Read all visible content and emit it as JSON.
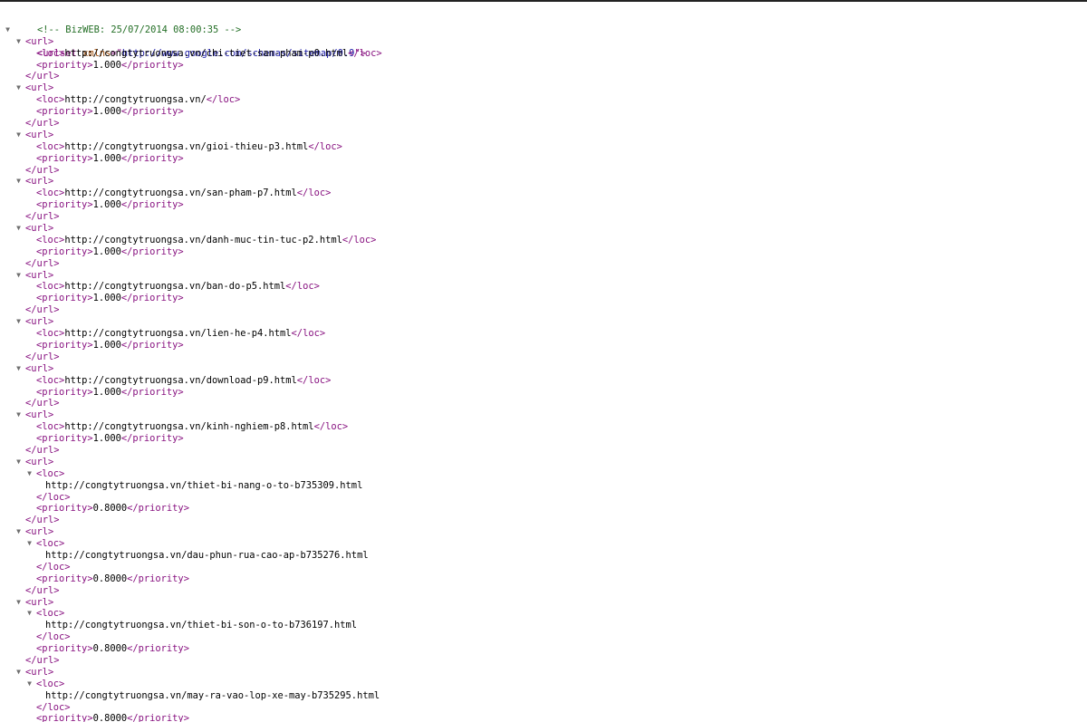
{
  "comment": "<!-- BizWEB: 25/07/2014 08:00:35 -->",
  "root_tag": "urlset",
  "root_attr_name": "xmlns",
  "root_attr_value": "http://www.google.com/schemas/sitemap/0.9",
  "tags": {
    "url": "url",
    "loc": "loc",
    "priority": "priority"
  },
  "fold_glyph": "▼",
  "urls": [
    {
      "loc": "http://congtytruongsa.vn/chi-tiet-san-pham-p0.html",
      "priority": "1.000",
      "expanded_loc": false
    },
    {
      "loc": "http://congtytruongsa.vn/",
      "priority": "1.000",
      "expanded_loc": false
    },
    {
      "loc": "http://congtytruongsa.vn/gioi-thieu-p3.html",
      "priority": "1.000",
      "expanded_loc": false
    },
    {
      "loc": "http://congtytruongsa.vn/san-pham-p7.html",
      "priority": "1.000",
      "expanded_loc": false
    },
    {
      "loc": "http://congtytruongsa.vn/danh-muc-tin-tuc-p2.html",
      "priority": "1.000",
      "expanded_loc": false
    },
    {
      "loc": "http://congtytruongsa.vn/ban-do-p5.html",
      "priority": "1.000",
      "expanded_loc": false
    },
    {
      "loc": "http://congtytruongsa.vn/lien-he-p4.html",
      "priority": "1.000",
      "expanded_loc": false
    },
    {
      "loc": "http://congtytruongsa.vn/download-p9.html",
      "priority": "1.000",
      "expanded_loc": false
    },
    {
      "loc": "http://congtytruongsa.vn/kinh-nghiem-p8.html",
      "priority": "1.000",
      "expanded_loc": false
    },
    {
      "loc": "http://congtytruongsa.vn/thiet-bi-nang-o-to-b735309.html",
      "priority": "0.8000",
      "expanded_loc": true
    },
    {
      "loc": "http://congtytruongsa.vn/dau-phun-rua-cao-ap-b735276.html",
      "priority": "0.8000",
      "expanded_loc": true
    },
    {
      "loc": "http://congtytruongsa.vn/thiet-bi-son-o-to-b736197.html",
      "priority": "0.8000",
      "expanded_loc": true
    },
    {
      "loc": "http://congtytruongsa.vn/may-ra-vao-lop-xe-may-b735295.html",
      "priority": "0.8000",
      "expanded_loc": true
    }
  ]
}
